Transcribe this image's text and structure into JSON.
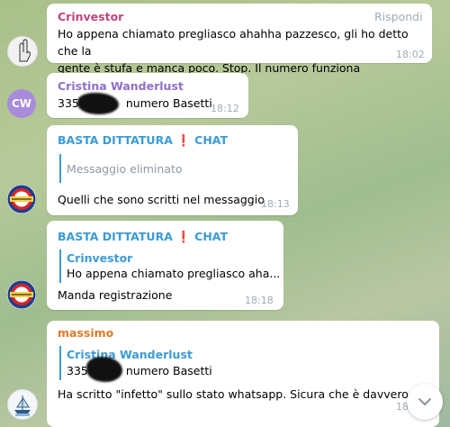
{
  "messages": [
    {
      "sender": "Crinvestor",
      "reply_label": "Rispondi",
      "text_lines": [
        "Ho appena chiamato pregliasco ahahha pazzesco, gli ho detto che la",
        "gente è stufa e manca poco. Stop. Il numero funziona"
      ],
      "time": "18:02"
    },
    {
      "sender": "Cristina Wanderlust",
      "avatar_initials": "CW",
      "text_prefix": "335",
      "text_suffix": "numero Basetti",
      "time": "18:12"
    },
    {
      "sender_name": "BASTA DITTATURA",
      "sender_exclaim": "❗",
      "sender_suffix": "CHAT",
      "reply_text": "Messaggio eliminato",
      "text": "Quelli che sono scritti nel messaggio",
      "time": "18:13"
    },
    {
      "sender_name": "BASTA DITTATURA",
      "sender_exclaim": "❗",
      "sender_suffix": "CHAT",
      "reply_name": "Crinvestor",
      "reply_text": "Ho appena chiamato pregliasco aha...",
      "text": "Manda registrazione",
      "time": "18:18"
    },
    {
      "sender": "massimo",
      "reply_name": "Cristina Wanderlust",
      "reply_prefix": "335",
      "reply_suffix": "numero Basetti",
      "text": "Ha scritto \"infetto\" sullo stato whatsapp. Sicura che è davvero lui?",
      "time": "18"
    }
  ],
  "colors": {
    "crinvestor": "#c1457a",
    "cristina": "#8e6fc9",
    "basta": "#3a9bd6",
    "massimo": "#e07b2c",
    "cw_avatar": "#a98bdc"
  },
  "icons": {
    "scroll_down": "chevron-down-icon"
  }
}
